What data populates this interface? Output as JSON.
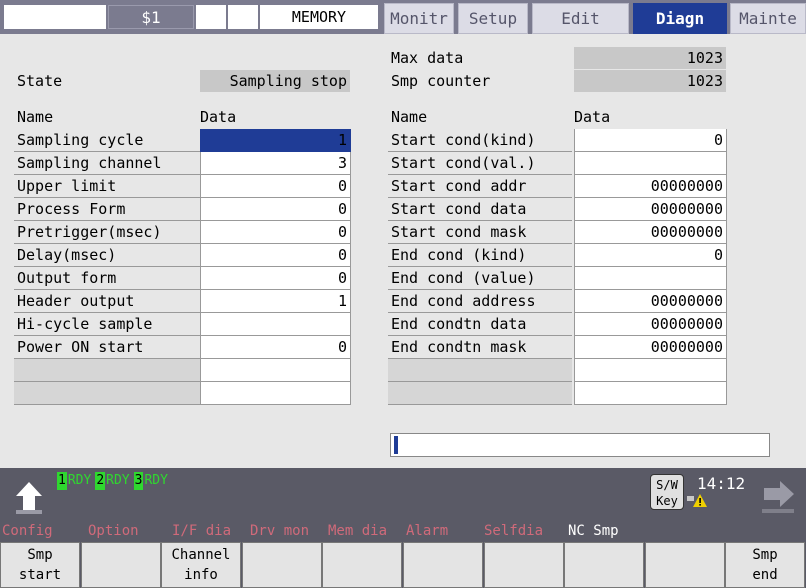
{
  "topbar": {
    "system": "$1",
    "mode": "MEMORY",
    "tabs": [
      {
        "label": "Monitr",
        "active": false
      },
      {
        "label": "Setup",
        "active": false
      },
      {
        "label": "Edit",
        "active": false
      },
      {
        "label": "Diagn",
        "active": true
      },
      {
        "label": "Mainte",
        "active": false
      }
    ]
  },
  "state": {
    "label": "State",
    "value": "Sampling stop"
  },
  "maxdata": {
    "label": "Max data",
    "value": "1023"
  },
  "smpcounter": {
    "label": "Smp counter",
    "value": "1023"
  },
  "left_table": {
    "name_header": "Name",
    "data_header": "Data",
    "rows": [
      {
        "name": "Sampling cycle",
        "value": "1"
      },
      {
        "name": "Sampling channel",
        "value": "3"
      },
      {
        "name": "Upper limit",
        "value": "0"
      },
      {
        "name": "Process Form",
        "value": "0"
      },
      {
        "name": "Pretrigger(msec)",
        "value": "0"
      },
      {
        "name": "Delay(msec)",
        "value": "0"
      },
      {
        "name": "Output form",
        "value": "0"
      },
      {
        "name": "Header output",
        "value": "1"
      },
      {
        "name": "Hi-cycle sample",
        "value": ""
      },
      {
        "name": "Power ON start",
        "value": "0"
      },
      {
        "name": "",
        "value": ""
      },
      {
        "name": "",
        "value": ""
      }
    ]
  },
  "right_table": {
    "name_header": "Name",
    "data_header": "Data",
    "rows": [
      {
        "name": "Start cond(kind)",
        "value": "0"
      },
      {
        "name": "Start cond(val.)",
        "value": ""
      },
      {
        "name": "Start cond addr",
        "value": "00000000"
      },
      {
        "name": "Start cond data",
        "value": "00000000"
      },
      {
        "name": "Start cond mask",
        "value": "00000000"
      },
      {
        "name": "End cond (kind)",
        "value": "0"
      },
      {
        "name": "End cond (value)",
        "value": ""
      },
      {
        "name": "End cond address",
        "value": "00000000"
      },
      {
        "name": "End condtn data",
        "value": "00000000"
      },
      {
        "name": "End condtn mask",
        "value": "00000000"
      },
      {
        "name": "",
        "value": ""
      },
      {
        "name": "",
        "value": ""
      }
    ]
  },
  "status": {
    "rdy": [
      {
        "num": "1",
        "text": "RDY"
      },
      {
        "num": "2",
        "text": "RDY"
      },
      {
        "num": "3",
        "text": "RDY"
      }
    ],
    "time": "14:12",
    "sw_key_line1": "S/W",
    "sw_key_line2": "Key"
  },
  "menu": {
    "items": [
      "Config",
      "Option",
      "I/F dia",
      "Drv mon",
      "Mem dia",
      "Alarm",
      "Selfdia",
      "NC Smp"
    ]
  },
  "softkeys": [
    {
      "line1": "Smp",
      "line2": "start"
    },
    {
      "line1": "",
      "line2": ""
    },
    {
      "line1": "Channel",
      "line2": "info"
    },
    {
      "line1": "",
      "line2": ""
    },
    {
      "line1": "",
      "line2": ""
    },
    {
      "line1": "",
      "line2": ""
    },
    {
      "line1": "",
      "line2": ""
    },
    {
      "line1": "",
      "line2": ""
    },
    {
      "line1": "",
      "line2": ""
    },
    {
      "line1": "Smp",
      "line2": "end"
    }
  ],
  "colors": {
    "accent": "#1f3c96",
    "rdy_green": "#2fd82f",
    "menu_text": "#d06a7a"
  }
}
